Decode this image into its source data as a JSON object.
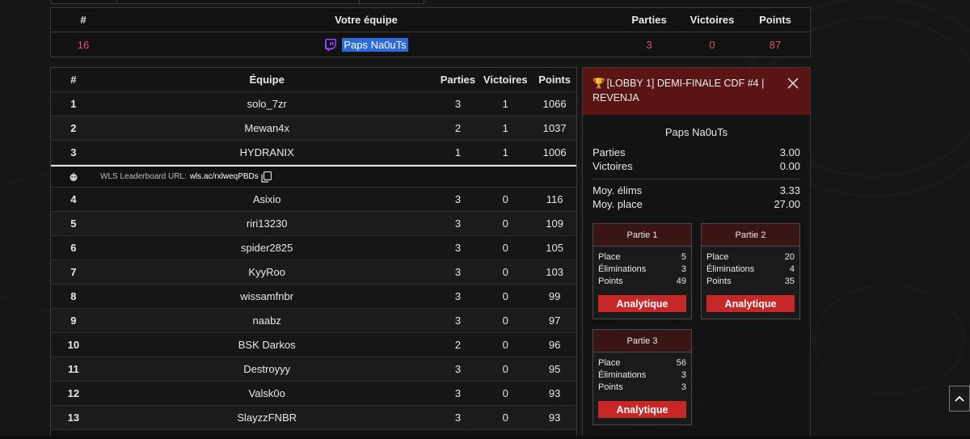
{
  "my_team": {
    "headers": {
      "rank": "#",
      "team": "Votre équipe",
      "parties": "Parties",
      "victoires": "Victoires",
      "points": "Points"
    },
    "row": {
      "rank": "16",
      "team": "Paps Na0uTs",
      "parties": "3",
      "victoires": "0",
      "points": "87"
    },
    "icon": "twitch-icon",
    "accent": "#9146ff"
  },
  "board": {
    "headers": {
      "rank": "#",
      "team": "Équipe",
      "parties": "Parties",
      "victoires": "Victoires",
      "points": "Points"
    },
    "top_rows": [
      {
        "rank": "1",
        "team": "solo_7zr",
        "parties": "3",
        "victoires": "1",
        "points": "1066"
      },
      {
        "rank": "2",
        "team": "Mewan4x",
        "parties": "2",
        "victoires": "1",
        "points": "1037"
      },
      {
        "rank": "3",
        "team": "HYDRANIX",
        "parties": "1",
        "victoires": "1",
        "points": "1006"
      }
    ],
    "url_row": {
      "label": "WLS Leaderboard URL:",
      "link": "wls.ac/rxlweqPBDs"
    },
    "rows": [
      {
        "rank": "4",
        "team": "Asixio",
        "parties": "3",
        "victoires": "0",
        "points": "116"
      },
      {
        "rank": "5",
        "team": "riri13230",
        "parties": "3",
        "victoires": "0",
        "points": "109"
      },
      {
        "rank": "6",
        "team": "spider2825",
        "parties": "3",
        "victoires": "0",
        "points": "105"
      },
      {
        "rank": "7",
        "team": "KyyRoo",
        "parties": "3",
        "victoires": "0",
        "points": "103"
      },
      {
        "rank": "8",
        "team": "wissamfnbr",
        "parties": "3",
        "victoires": "0",
        "points": "99"
      },
      {
        "rank": "9",
        "team": "naabz",
        "parties": "3",
        "victoires": "0",
        "points": "97"
      },
      {
        "rank": "10",
        "team": "BSK Darkos",
        "parties": "2",
        "victoires": "0",
        "points": "96"
      },
      {
        "rank": "11",
        "team": "Destroyyy",
        "parties": "3",
        "victoires": "0",
        "points": "95"
      },
      {
        "rank": "12",
        "team": "Valsk0o",
        "parties": "3",
        "victoires": "0",
        "points": "93"
      },
      {
        "rank": "13",
        "team": "SlayzzFNBR",
        "parties": "3",
        "victoires": "0",
        "points": "93"
      }
    ]
  },
  "detail": {
    "title": "[LOBBY 1] DEMI-FINALE CDF #4 | REVENJA",
    "player": "Paps Na0uTs",
    "stats": [
      {
        "label": "Parties",
        "value": "3.00"
      },
      {
        "label": "Victoires",
        "value": "0.00"
      }
    ],
    "stats2": [
      {
        "label": "Moy. élims",
        "value": "3.33"
      },
      {
        "label": "Moy. place",
        "value": "27.00"
      }
    ],
    "games": [
      {
        "title": "Partie 1",
        "lines": [
          {
            "label": "Place",
            "value": "5"
          },
          {
            "label": "Éliminations",
            "value": "3"
          },
          {
            "label": "Points",
            "value": "49"
          }
        ],
        "button": "Analytique"
      },
      {
        "title": "Partie 2",
        "lines": [
          {
            "label": "Place",
            "value": "20"
          },
          {
            "label": "Éliminations",
            "value": "4"
          },
          {
            "label": "Points",
            "value": "35"
          }
        ],
        "button": "Analytique"
      },
      {
        "title": "Partie 3",
        "lines": [
          {
            "label": "Place",
            "value": "56"
          },
          {
            "label": "Éliminations",
            "value": "3"
          },
          {
            "label": "Points",
            "value": "3"
          }
        ],
        "button": "Analytique"
      }
    ],
    "header_color": "#5a1414",
    "button_color": "#c62828"
  }
}
